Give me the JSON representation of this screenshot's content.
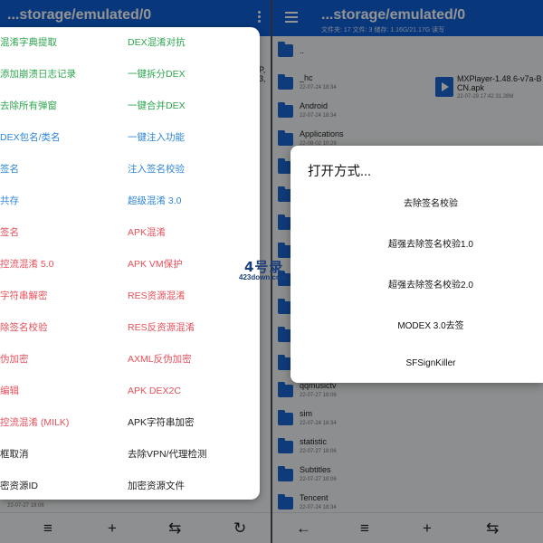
{
  "left_pane": {
    "title": "...storage/emulated/0",
    "partial_row_date": "22-07-27 18:06",
    "right_edge_fragments": [
      "P,",
      "3,"
    ],
    "bottom_bar": [
      "list-icon",
      "plus-icon",
      "swap-icon",
      "refresh-icon"
    ]
  },
  "right_pane": {
    "title": "...storage/emulated/0",
    "subtitle": "文件夹: 17   文件: 3   储存: 1.16G/21.17G      读写",
    "files": [
      {
        "name": "..",
        "date": ""
      },
      {
        "name": "_hc",
        "date": "22-07-24 18:34"
      },
      {
        "name": "Android",
        "date": "22-07-24 18:34"
      },
      {
        "name": "Applications",
        "date": "22-08-02 10:29"
      },
      {
        "name": "qqmusictv",
        "date": "22-07-27 18:06"
      },
      {
        "name": "sim",
        "date": "22-07-24 18:34"
      },
      {
        "name": "statistic",
        "date": "22-07-27 18:06"
      },
      {
        "name": "Subtitles",
        "date": "22-07-27 18:06"
      },
      {
        "name": "Tencent",
        "date": "22-07-24 18:34"
      }
    ],
    "apk_file": {
      "name_line1": "MXPlayer-1.48.6-v7a-B",
      "name_line2": "CN.apk",
      "meta": "22-07-29 17:42  31.28M"
    },
    "bottom_bar": [
      "back-arrow-icon",
      "list-icon",
      "plus-icon",
      "swap-icon"
    ]
  },
  "tools_menu": {
    "left_column": [
      {
        "label": "混淆字典提取",
        "color": "green"
      },
      {
        "label": "添加崩溃日志记录",
        "color": "green"
      },
      {
        "label": "去除所有弹窗",
        "color": "green"
      },
      {
        "label": "DEX包名/类名",
        "color": "blue"
      },
      {
        "label": "签名",
        "color": "blue"
      },
      {
        "label": "共存",
        "color": "blue"
      },
      {
        "label": "签名",
        "color": "red"
      },
      {
        "label": "控流混淆 5.0",
        "color": "red"
      },
      {
        "label": "字符串解密",
        "color": "red"
      },
      {
        "label": "除签名校验",
        "color": "red"
      },
      {
        "label": "伪加密",
        "color": "red"
      },
      {
        "label": "编辑",
        "color": "red"
      },
      {
        "label": "控流混淆 (MILK)",
        "color": "red"
      },
      {
        "label": "框取消",
        "color": "black"
      },
      {
        "label": "密资源ID",
        "color": "black"
      }
    ],
    "right_column": [
      {
        "label": "DEX混淆对抗",
        "color": "green"
      },
      {
        "label": "一键拆分DEX",
        "color": "green"
      },
      {
        "label": "一键合并DEX",
        "color": "green"
      },
      {
        "label": "一键注入功能",
        "color": "blue"
      },
      {
        "label": "注入签名校验",
        "color": "blue"
      },
      {
        "label": "超级混淆 3.0",
        "color": "blue"
      },
      {
        "label": "APK混淆",
        "color": "red"
      },
      {
        "label": "APK VM保护",
        "color": "red"
      },
      {
        "label": "RES资源混淆",
        "color": "red"
      },
      {
        "label": "RES反资源混淆",
        "color": "red"
      },
      {
        "label": "AXML反伪加密",
        "color": "red"
      },
      {
        "label": "APK DEX2C",
        "color": "red"
      },
      {
        "label": "APK字符串加密",
        "color": "black"
      },
      {
        "label": "去除VPN/代理检测",
        "color": "black"
      },
      {
        "label": "加密资源文件",
        "color": "black"
      }
    ]
  },
  "open_with_dialog": {
    "title": "打开方式...",
    "options": [
      "去除签名校验",
      "超强去除签名校验1.0",
      "超强去除签名校验2.0",
      "MODEX 3.0去签",
      "SFSignKiller"
    ]
  },
  "watermark": {
    "line1": "4号录",
    "line2": "423down.com"
  },
  "colors": {
    "green": "#2ea54f",
    "blue": "#2f86d6",
    "red": "#e5505a",
    "black": "#202020",
    "toolbar": "#0f5fd6",
    "folder": "#1a66d2"
  }
}
